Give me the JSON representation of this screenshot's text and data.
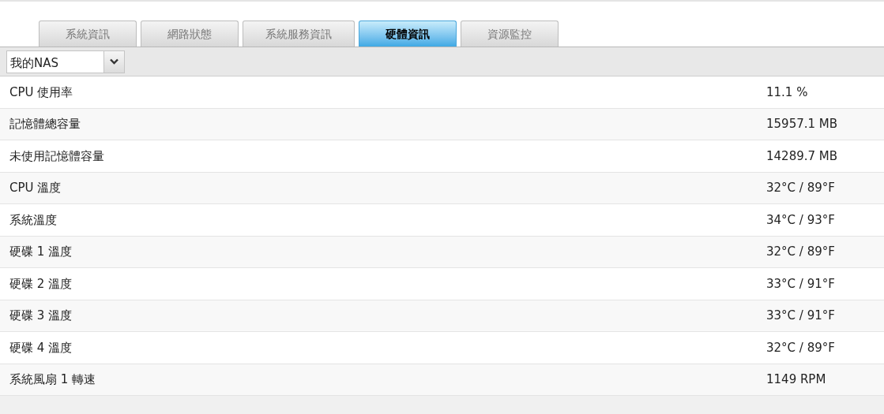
{
  "tabs": [
    {
      "label": "系統資訊",
      "selected": false
    },
    {
      "label": "網路狀態",
      "selected": false
    },
    {
      "label": "系統服務資訊",
      "selected": false
    },
    {
      "label": "硬體資訊",
      "selected": true
    },
    {
      "label": "資源監控",
      "selected": false
    }
  ],
  "device_select": {
    "value": "我的NAS"
  },
  "rows": [
    {
      "label": "CPU 使用率",
      "value": "11.1 %"
    },
    {
      "label": "記憶體總容量",
      "value": "15957.1 MB"
    },
    {
      "label": "未使用記憶體容量",
      "value": "14289.7 MB"
    },
    {
      "label": "CPU 溫度",
      "value": "32°C / 89°F"
    },
    {
      "label": "系統溫度",
      "value": "34°C / 93°F"
    },
    {
      "label": "硬碟 1 溫度",
      "value": "32°C / 89°F"
    },
    {
      "label": "硬碟 2 溫度",
      "value": "33°C / 91°F"
    },
    {
      "label": "硬碟 3 溫度",
      "value": "33°C / 91°F"
    },
    {
      "label": "硬碟 4 溫度",
      "value": "32°C / 89°F"
    },
    {
      "label": "系統風扇 1 轉速",
      "value": "1149 RPM"
    }
  ]
}
